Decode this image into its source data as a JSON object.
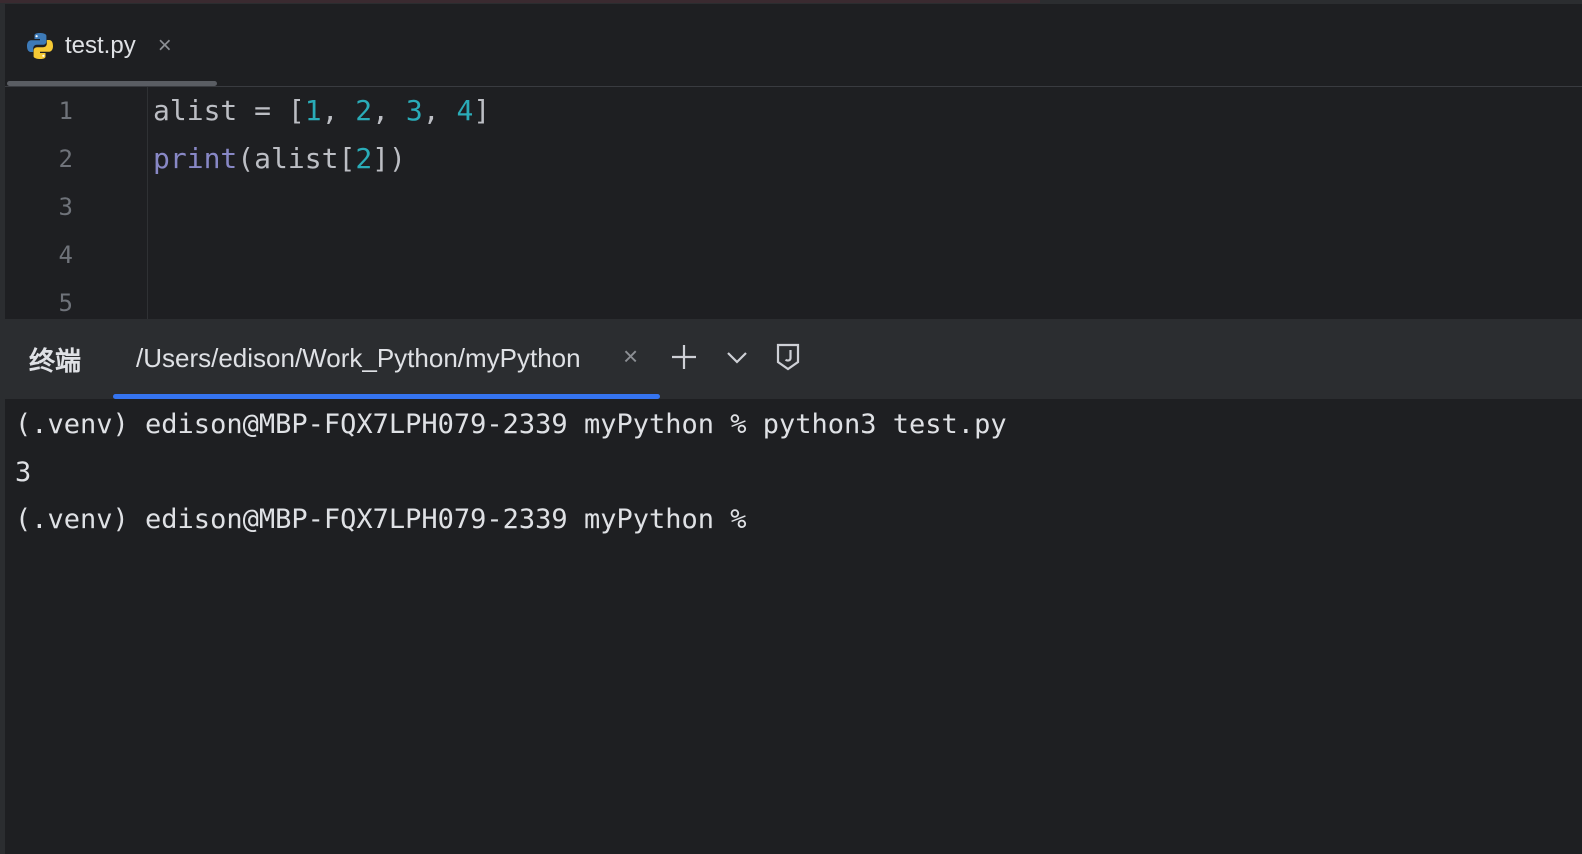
{
  "colors": {
    "background": "#1e1f22",
    "panel": "#2b2d30",
    "text": "#dfe1e5",
    "number": "#2aacb8",
    "builtin": "#8888c6",
    "line_number": "#6f737a",
    "active_tab_underline": "#3574f0"
  },
  "editor": {
    "tab": {
      "icon": "python-file-icon",
      "label": "test.py",
      "close": "×"
    },
    "line_numbers": [
      "1",
      "2",
      "3",
      "4",
      "5"
    ],
    "code": {
      "line1": {
        "prefix": "alist = [",
        "n1": "1",
        "sep1": ", ",
        "n2": "2",
        "sep2": ", ",
        "n3": "3",
        "sep3": ", ",
        "n4": "4",
        "suffix": "]"
      },
      "line2": {
        "builtin": "print",
        "prefix": "(alist[",
        "n": "2",
        "suffix": "])"
      }
    }
  },
  "terminal": {
    "title": "终端",
    "tab_label": "/Users/edison/Work_Python/myPython",
    "tab_close": "×",
    "buttons": {
      "new": "plus-icon",
      "dropdown": "chevron-down-icon",
      "shell": "shield-j-icon"
    },
    "lines": [
      "(.venv) edison@MBP-FQX7LPH079-2339 myPython % python3 test.py",
      "3",
      "(.venv) edison@MBP-FQX7LPH079-2339 myPython %"
    ]
  }
}
